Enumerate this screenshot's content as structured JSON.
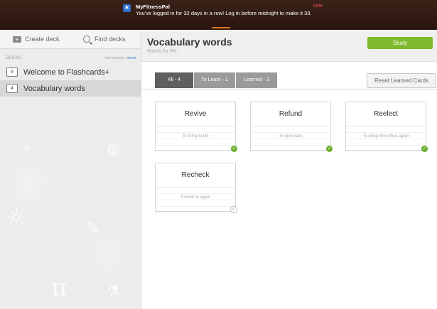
{
  "notification": {
    "app": "MyFitnessPal",
    "time": "now",
    "message": "You've logged in for 32 days in a row! Log in before midnight to make it 33."
  },
  "sidebar": {
    "create_label": "Create deck",
    "find_label": "Find decks",
    "decks_label": "DECKS",
    "backup_prefix": "last backup:",
    "backup_value": "never",
    "decks": [
      {
        "count": "9",
        "name": "Welcome to Flashcards+"
      },
      {
        "count": "4",
        "name": "Vocabulary words"
      }
    ]
  },
  "main": {
    "title": "Vocabulary words",
    "subtitle": "Words for Re-",
    "study_label": "Study",
    "tabs": [
      {
        "label": "All - 4"
      },
      {
        "label": "To Learn - 1"
      },
      {
        "label": "Learned - 3"
      }
    ],
    "reset_label": "Reset Learned Cards",
    "cards": [
      {
        "front": "Revive",
        "back": "To bring to life",
        "learned": true
      },
      {
        "front": "Refund",
        "back": "To give back",
        "learned": true
      },
      {
        "front": "Reelect",
        "back": "To bring into office again",
        "learned": true
      },
      {
        "front": "Recheck",
        "back": "To look at again",
        "learned": false
      }
    ]
  },
  "colors": {
    "accent_green": "#7fba2c",
    "check_green": "#6cae2c",
    "tab_active": "#5f5f5f",
    "notification_time": "#ff4d4d"
  }
}
